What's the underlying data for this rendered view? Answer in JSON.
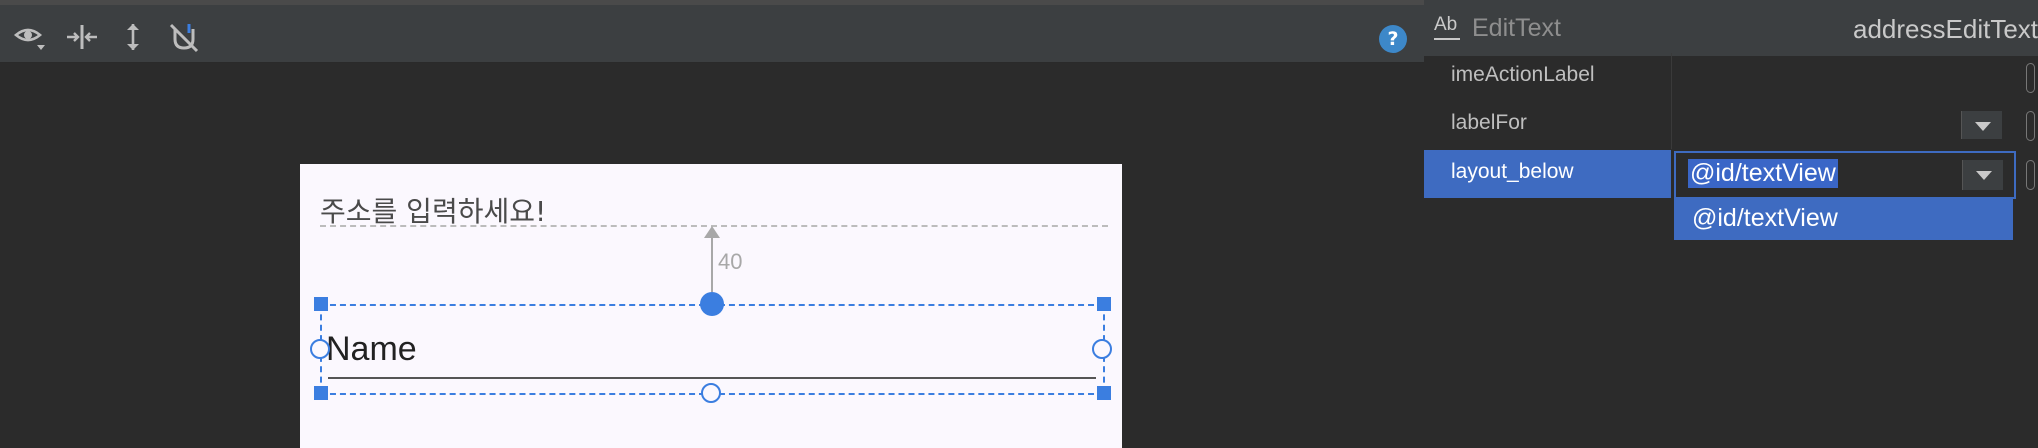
{
  "toolbar": {
    "icons": [
      "eye-icon",
      "horizontal-constraint-icon",
      "vertical-constraint-icon",
      "clear-constraints-icon"
    ],
    "help_label": "?"
  },
  "canvas": {
    "hint_text": "주소를 입력하세요!",
    "margin_value": "40",
    "edit_text": "Name"
  },
  "properties": {
    "widget_icon": "Ab",
    "widget_type": "EditText",
    "widget_id": "addressEditText",
    "rows": [
      {
        "name": "imeActionLabel",
        "value": ""
      },
      {
        "name": "labelFor",
        "value": ""
      },
      {
        "name": "layout_below",
        "value": "@id/textView"
      }
    ],
    "dropdown_options": [
      "@id/textView"
    ]
  },
  "colors": {
    "accent": "#3b7ee0",
    "selection": "#3e6bc1",
    "panel": "#3c3f41",
    "background": "#2b2b2b"
  }
}
